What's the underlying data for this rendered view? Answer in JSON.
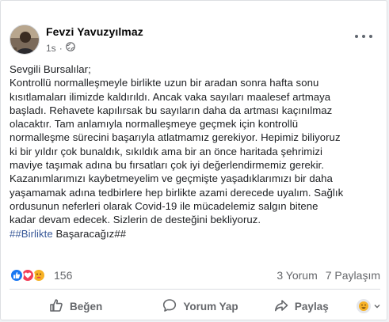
{
  "post": {
    "author": "Fevzi Yavuzyılmaz",
    "time": "1s",
    "separator": "·",
    "text_lines": [
      "Sevgili Bursalılar;",
      "Kontrollü normalleşmeyle birlikte uzun bir aradan sonra hafta sonu",
      "kısıtlamaları ilimizde kaldırıldı. Ancak vaka sayıları  maalesef artmaya",
      "başladı.  Rehavete kapılırsak bu sayıların daha da artması kaçınılmaz",
      "olacaktır. Tam anlamıyla normalleşmeye geçmek için kontrollü",
      "normalleşme sürecini başarıyla atlatmamız gerekiyor. Hepimiz biliyoruz",
      "ki bir yıldır çok bunaldık, sıkıldık ama bir an önce haritada şehrimizi",
      "maviye taşımak adına bu fırsatları çok iyi değerlendirmemiz gerekir.",
      "Kazanımlarımızı kaybetmeyelim ve geçmişte yaşadıklarımızı  bir daha",
      "yaşamamak adına tedbirlere hep birlikte azami derecede uyalım. Sağlık",
      "ordusunun neferleri olarak Covid-19 ile mücadelemiz salgın bitene",
      "kadar devam edecek. Sizlerin de desteğini bekliyoruz."
    ],
    "hashtag_prefix": "#",
    "hashtag_link": "#Birlikte",
    "hashtag_suffix": " Başaracağız##"
  },
  "stats": {
    "reaction_count": "156",
    "comments": "3 Yorum",
    "shares": "7 Paylaşım"
  },
  "actions": {
    "like": "Beğen",
    "comment": "Yorum Yap",
    "share": "Paylaş"
  },
  "icons": {
    "more": "more-options-icon",
    "audience": "globe-icon",
    "like": "thumbs-up-icon",
    "comment": "comment-bubble-icon",
    "share": "share-arrow-icon"
  },
  "colors": {
    "accent": "#385898",
    "like_blue": "#1877f2",
    "love_red": "#f33e58",
    "care_yellow": "#f7b125",
    "secondary_text": "#65676b"
  }
}
